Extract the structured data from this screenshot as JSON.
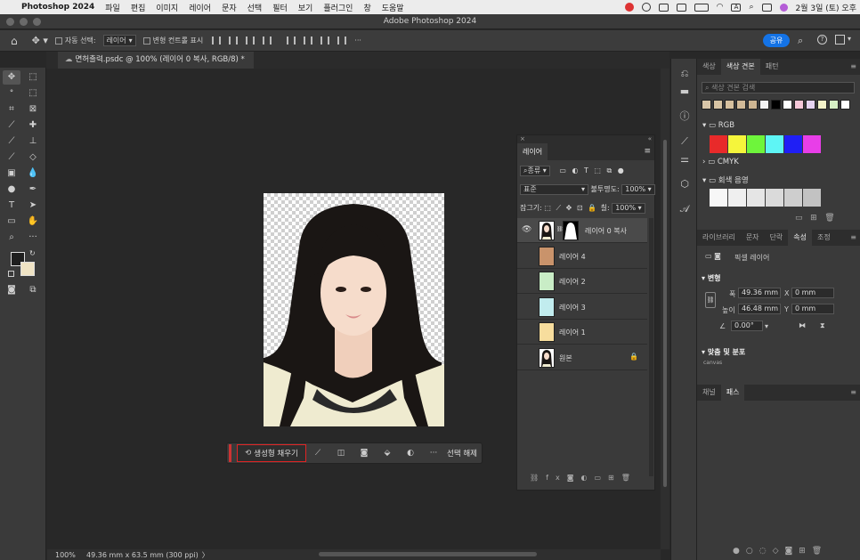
{
  "menubar": {
    "app": "Photoshop 2024",
    "items": [
      "파일",
      "편집",
      "이미지",
      "레이어",
      "문자",
      "선택",
      "필터",
      "보기",
      "플러그인",
      "창",
      "도움말"
    ],
    "date": "2월 3일 (토) 오후",
    "input_indicator": "A"
  },
  "window": {
    "title": "Adobe Photoshop 2024"
  },
  "options": {
    "auto_select_label": "자동 선택:",
    "auto_select_value": "레이어",
    "transform_controls_label": "변형 컨트롤 표시",
    "share_label": "공유"
  },
  "document": {
    "tab_title": "면허출력.psdc @ 100% (레이어 0 복사, RGB/8) *"
  },
  "context_bar": {
    "generative_fill": "생성형 채우기",
    "deselect": "선택 해제"
  },
  "status": {
    "zoom": "100%",
    "doc_info": "49.36 mm x 63.5 mm (300 ppi)"
  },
  "swatches_panel": {
    "tabs": [
      "색상",
      "색상 견본",
      "패턴"
    ],
    "active_tab": "색상 견본",
    "search_placeholder": "색상 견본 검색",
    "recent": [
      "#d9c6a8",
      "#d8c4a3",
      "#d6c09e",
      "#d3bb98",
      "#cfb692",
      "#f2f2f2",
      "#000000",
      "#ffffff",
      "#f5c8d8",
      "#e6d3f0",
      "#f3f2c8",
      "#d6f0c4",
      "#ffffff"
    ],
    "groups": [
      {
        "name": "RGB",
        "colors": [
          "#e82a2a",
          "#f5f53b",
          "#6ef53b",
          "#5ef5f5",
          "#1f1ff5",
          "#e83ee8"
        ]
      },
      {
        "name": "CMYK",
        "colors": []
      },
      {
        "name": "회색 음영",
        "colors": [
          "#f7f7f7",
          "#efefef",
          "#e5e5e5",
          "#dadada",
          "#cecece",
          "#c2c2c2"
        ]
      }
    ]
  },
  "properties_panel": {
    "tabs": [
      "라이브러리",
      "문자",
      "단락",
      "속성",
      "조정"
    ],
    "active_tab": "속성",
    "layer_type": "픽셀 레이어",
    "transform_title": "변형",
    "w_label": "폭",
    "w_value": "49.36 mm",
    "h_label": "높이",
    "h_value": "46.48 mm",
    "x_label": "X",
    "x_value": "0 mm",
    "y_label": "Y",
    "y_value": "0 mm",
    "angle_value": "0.00°",
    "align_title": "맞춤 및 분포",
    "align_sub": "canvas"
  },
  "bottom_panel": {
    "tabs": [
      "채널",
      "패스"
    ],
    "active_tab": "패스"
  },
  "layers_panel": {
    "title": "레이어",
    "filter_label": "종류",
    "blend_mode": "표준",
    "opacity_label": "불투명도:",
    "opacity_value": "100%",
    "lock_label": "잠그기:",
    "fill_label": "칠:",
    "fill_value": "100%",
    "layers": [
      {
        "name": "레이어 0 복사",
        "color": "#ffffff",
        "selected": true,
        "visible": true,
        "mask": true,
        "photo": true
      },
      {
        "name": "레이어 4",
        "color": "#c9936b",
        "selected": false,
        "visible": false
      },
      {
        "name": "레이어 2",
        "color": "#c9edc6",
        "selected": false,
        "visible": false
      },
      {
        "name": "레이어 3",
        "color": "#c1ecee",
        "selected": false,
        "visible": false
      },
      {
        "name": "레이어 1",
        "color": "#f7dd9d",
        "selected": false,
        "visible": false
      },
      {
        "name": "원본",
        "color": "#ffffff",
        "selected": false,
        "visible": false,
        "photo": true,
        "locked": true
      }
    ]
  }
}
